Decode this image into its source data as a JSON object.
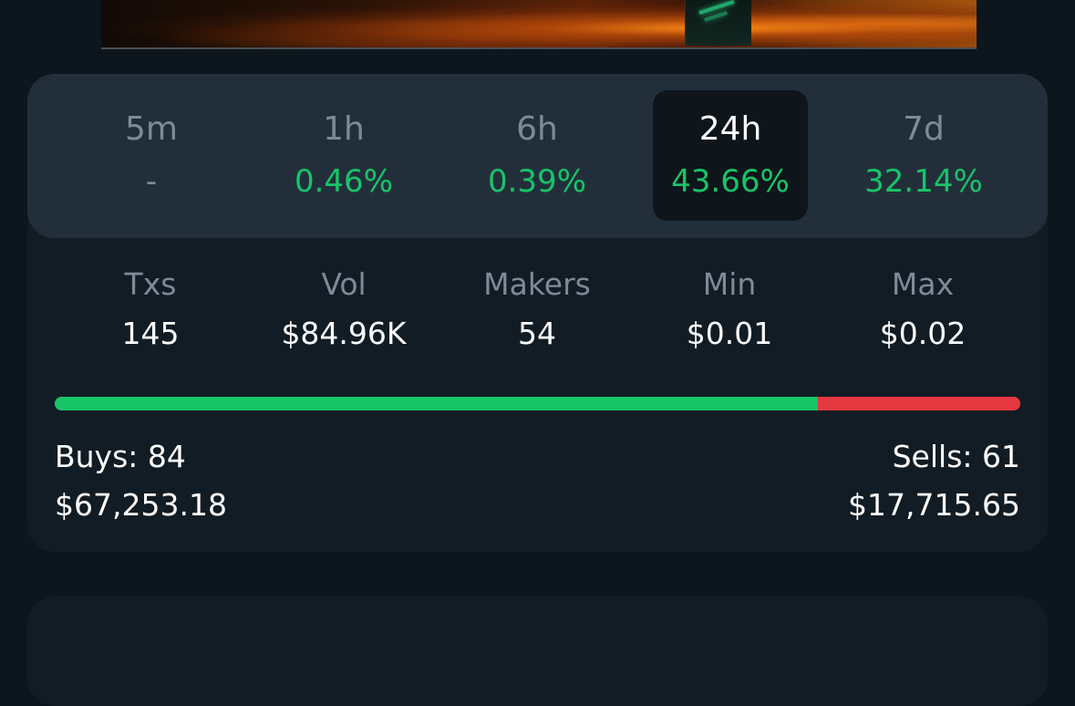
{
  "periods": [
    {
      "label": "5m",
      "value": "-",
      "selected": false
    },
    {
      "label": "1h",
      "value": "0.46%",
      "selected": false
    },
    {
      "label": "6h",
      "value": "0.39%",
      "selected": false
    },
    {
      "label": "24h",
      "value": "43.66%",
      "selected": true
    },
    {
      "label": "7d",
      "value": "32.14%",
      "selected": false
    }
  ],
  "stats": [
    {
      "label": "Txs",
      "value": "145"
    },
    {
      "label": "Vol",
      "value": "$84.96K"
    },
    {
      "label": "Makers",
      "value": "54"
    },
    {
      "label": "Min",
      "value": "$0.01"
    },
    {
      "label": "Max",
      "value": "$0.02"
    }
  ],
  "trades": {
    "buys_label": "Buys: 84",
    "buys_amount": "$67,253.18",
    "sells_label": "Sells: 61",
    "sells_amount": "$17,715.65",
    "buy_ratio": 0.79
  },
  "colors": {
    "positive": "#17c468",
    "negative": "#e5383f",
    "background": "#0d161d",
    "card": "#121c24",
    "tab_strip": "#222f3b",
    "selected_tab": "#0e151b"
  }
}
